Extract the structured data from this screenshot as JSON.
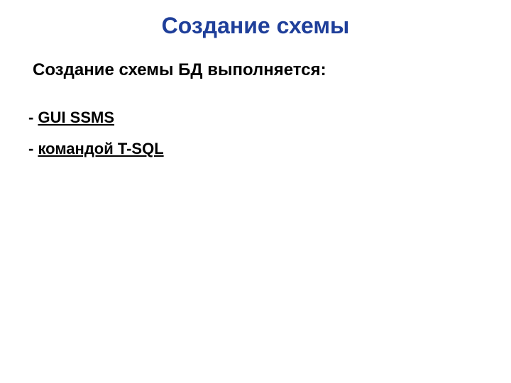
{
  "title": {
    "text": "Создание схемы",
    "color": "#1f3f9a"
  },
  "subtitle": "Создание схемы БД выполняется:",
  "bullets": [
    {
      "dash": "- ",
      "label": "GUI SSMS"
    },
    {
      "dash": "- ",
      "label": "командой T-SQL"
    }
  ]
}
